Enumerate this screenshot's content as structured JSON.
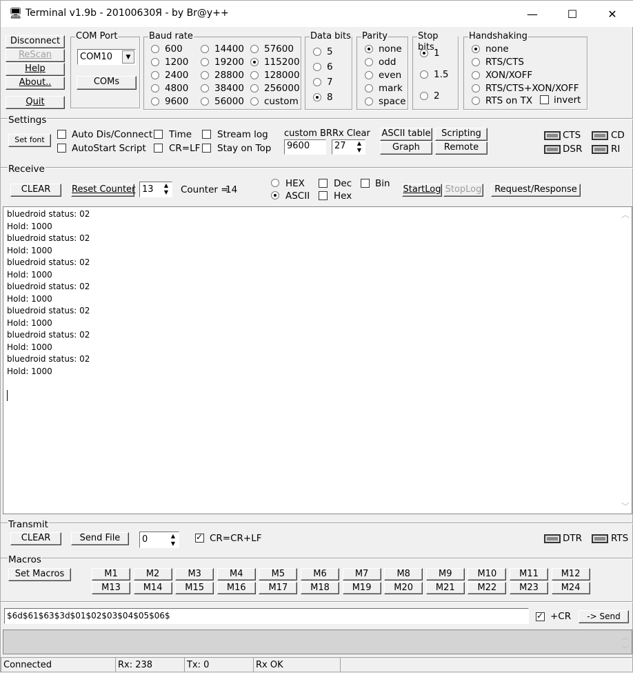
{
  "window": {
    "title": "Terminal v1.9b - 20100630Я - by Br@y++",
    "minimize": "—",
    "maximize": "☐",
    "close": "✕"
  },
  "leftButtons": {
    "disconnect": "Disconnect",
    "rescan": "ReScan",
    "help": "Help",
    "about": "About..",
    "quit": "Quit"
  },
  "comPort": {
    "label": "COM Port",
    "value": "COM10",
    "coms": "COMs"
  },
  "baudRate": {
    "label": "Baud rate",
    "options": [
      "600",
      "1200",
      "2400",
      "4800",
      "9600",
      "14400",
      "19200",
      "28800",
      "38400",
      "56000",
      "57600",
      "115200",
      "128000",
      "256000",
      "custom"
    ],
    "selected": "115200"
  },
  "dataBits": {
    "label": "Data bits",
    "options": [
      "5",
      "6",
      "7",
      "8"
    ],
    "selected": "8"
  },
  "parity": {
    "label": "Parity",
    "options": [
      "none",
      "odd",
      "even",
      "mark",
      "space"
    ],
    "selected": "none"
  },
  "stopBits": {
    "label": "Stop bits",
    "options": [
      "1",
      "1.5",
      "2"
    ],
    "selected": "1"
  },
  "handshaking": {
    "label": "Handshaking",
    "options": [
      "none",
      "RTS/CTS",
      "XON/XOFF",
      "RTS/CTS+XON/XOFF",
      "RTS on TX"
    ],
    "selected": "none",
    "invert": "invert"
  },
  "settings": {
    "label": "Settings",
    "setFont": "Set font",
    "autoDis": "Auto Dis/Connect",
    "autoStart": "AutoStart Script",
    "time": "Time",
    "crlf": "CR=LF",
    "streamLog": "Stream log",
    "stayOnTop": "Stay on Top",
    "customBR": "custom BR",
    "customBRValue": "9600",
    "rxClear": "Rx Clear",
    "rxClearValue": "27",
    "asciiTable": "ASCII table",
    "graph": "Graph",
    "scripting": "Scripting",
    "remote": "Remote",
    "cts": "CTS",
    "cd": "CD",
    "dsr": "DSR",
    "ri": "RI"
  },
  "receive": {
    "label": "Receive",
    "clear": "CLEAR",
    "resetCounter": "Reset Counter",
    "counterSpin": "13",
    "counterLabel": "Counter = ",
    "counterValue": "14",
    "hex": "HEX",
    "ascii": "ASCII",
    "dec": "Dec",
    "hexChk": "Hex",
    "bin": "Bin",
    "startLog": "StartLog",
    "stopLog": "StopLog",
    "reqResp": "Request/Response"
  },
  "terminal": {
    "lines": [
      "bluedroid status: 02",
      "Hold: 1000",
      "bluedroid status: 02",
      "Hold: 1000",
      "bluedroid status: 02",
      "Hold: 1000",
      "bluedroid status: 02",
      "Hold: 1000",
      "bluedroid status: 02",
      "Hold: 1000",
      "bluedroid status: 02",
      "Hold: 1000",
      "bluedroid status: 02",
      "Hold: 1000"
    ]
  },
  "transmit": {
    "label": "Transmit",
    "clear": "CLEAR",
    "sendFile": "Send File",
    "spinValue": "0",
    "crcrlf": "CR=CR+LF",
    "dtr": "DTR",
    "rts": "RTS"
  },
  "macros": {
    "label": "Macros",
    "setMacros": "Set Macros",
    "row1": [
      "M1",
      "M2",
      "M3",
      "M4",
      "M5",
      "M6",
      "M7",
      "M8",
      "M9",
      "M10",
      "M11",
      "M12"
    ],
    "row2": [
      "M13",
      "M14",
      "M15",
      "M16",
      "M17",
      "M18",
      "M19",
      "M20",
      "M21",
      "M22",
      "M23",
      "M24"
    ]
  },
  "send": {
    "input": "$6d$61$63$3d$01$02$03$04$05$06$",
    "cr": "+CR",
    "sendBtn": "-> Send"
  },
  "status": {
    "connected": "Connected",
    "rx": "Rx: 238",
    "tx": "Tx: 0",
    "rxok": "Rx OK"
  }
}
